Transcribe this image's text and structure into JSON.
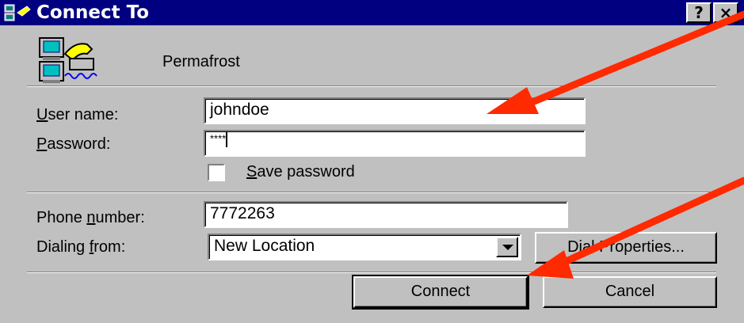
{
  "window": {
    "title": "Connect To",
    "help_button": "?",
    "close_button": "×"
  },
  "connection": {
    "name": "Permafrost",
    "icon": "dial-up-networking-icon"
  },
  "fields": {
    "username": {
      "label_first": "U",
      "label_rest": "ser name:",
      "value": "johndoe"
    },
    "password": {
      "label_first": "P",
      "label_rest": "assword:",
      "value": "****"
    },
    "save_password": {
      "label_first": "S",
      "label_rest": "ave password",
      "checked": false
    },
    "phone": {
      "label_prefix": "Phone ",
      "label_accel": "n",
      "label_rest": "umber:",
      "value": "7772263"
    },
    "dialing_from": {
      "label_prefix": "Dialing ",
      "label_accel": "f",
      "label_rest": "rom:",
      "value": "New Location"
    }
  },
  "buttons": {
    "dial_properties": "Dial Properties...",
    "connect": "Connect",
    "cancel": "Cancel"
  },
  "colors": {
    "title_bar": "#000080",
    "dialog_face": "#c0c0c0",
    "annotation_arrow": "#ff2a00"
  }
}
